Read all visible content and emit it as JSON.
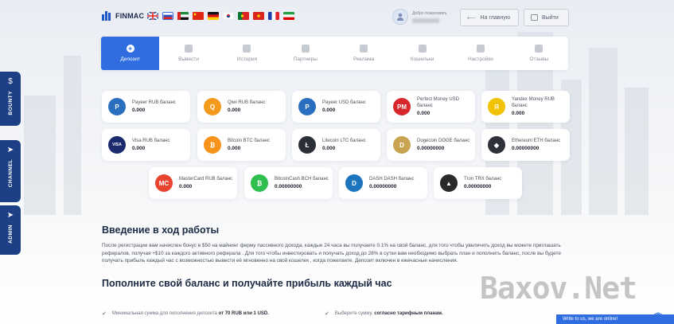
{
  "header": {
    "logo_text": "FINMAC",
    "languages": [
      "en",
      "ru",
      "ae",
      "cn",
      "de",
      "kr",
      "pt",
      "vn",
      "fr",
      "ir"
    ],
    "user_greeting": "Добро пожаловать",
    "home_button": "На главную",
    "logout_button": "Выйти"
  },
  "tabs": [
    {
      "label": "Депозит",
      "icon": "plus-icon",
      "active": true
    },
    {
      "label": "Вывести",
      "icon": "withdraw-icon",
      "active": false
    },
    {
      "label": "История",
      "icon": "history-icon",
      "active": false
    },
    {
      "label": "Партнеры",
      "icon": "partners-icon",
      "active": false
    },
    {
      "label": "Реклама",
      "icon": "ads-icon",
      "active": false
    },
    {
      "label": "Кошельки",
      "icon": "wallet-icon",
      "active": false
    },
    {
      "label": "Настройки",
      "icon": "gear-icon",
      "active": false
    },
    {
      "label": "Отзывы",
      "icon": "reviews-icon",
      "active": false
    }
  ],
  "balances": [
    {
      "label": "Payeer RUB баланс",
      "value": "0.000",
      "icon": "payeer-icon",
      "color": "#2a6fbf",
      "glyph": "P"
    },
    {
      "label": "Qiwi RUB баланс",
      "value": "0.000",
      "icon": "qiwi-icon",
      "color": "#f39a1d",
      "glyph": "Q"
    },
    {
      "label": "Payeer USD баланс",
      "value": "0.000",
      "icon": "payeer-icon",
      "color": "#2a6fbf",
      "glyph": "P"
    },
    {
      "label": "Perfect Money USD баланс",
      "value": "0.000",
      "icon": "perfect-money-icon",
      "color": "#d8262d",
      "glyph": "PM"
    },
    {
      "label": "Yandex Money RUB баланс",
      "value": "0.000",
      "icon": "yandex-money-icon",
      "color": "#f2c200",
      "glyph": "Я"
    },
    {
      "label": "Visa RUB баланс",
      "value": "0.000",
      "icon": "visa-icon",
      "color": "#1a2a6c",
      "glyph": "VISA"
    },
    {
      "label": "Bitcoin BTC баланс",
      "value": "0.000",
      "icon": "bitcoin-icon",
      "color": "#f7931a",
      "glyph": "₿"
    },
    {
      "label": "Litecoin LTC баланс",
      "value": "0.000",
      "icon": "litecoin-icon",
      "color": "#2b2f36",
      "glyph": "Ł"
    },
    {
      "label": "Dogecoin DOGE баланс",
      "value": "0.00000000",
      "icon": "dogecoin-icon",
      "color": "#c8a450",
      "glyph": "D"
    },
    {
      "label": "Ethereum ETH баланс",
      "value": "0.00000000",
      "icon": "ethereum-icon",
      "color": "#2e3138",
      "glyph": "◆"
    },
    {
      "label": "MasterCard RUB баланс",
      "value": "0.000",
      "icon": "mastercard-icon",
      "color": "#e8442f",
      "glyph": "MC"
    },
    {
      "label": "BitcoinCash BCH баланс",
      "value": "0.00000000",
      "icon": "bitcoin-cash-icon",
      "color": "#2fbf4f",
      "glyph": "₿"
    },
    {
      "label": "DASH DASH баланс",
      "value": "0.00000000",
      "icon": "dash-icon",
      "color": "#1c75bc",
      "glyph": "D"
    },
    {
      "label": "Tron TRX баланс",
      "value": "0.00000000",
      "icon": "tron-icon",
      "color": "#2a2a2a",
      "glyph": "▲"
    }
  ],
  "intro": {
    "title": "Введение в ход работы",
    "text": "После регистрации вам начислен бонус в $50 на майнинг ферму пассивного дохода, каждые 24 часа вы получаете 0.1% на свой баланс, для того чтобы увеличить доход вы можете приглашать рефералов, получая +$10 за каждого активного реферала . Для того чтобы инвестировать и получать доход до 28% в сутки вам необходимо выбрать план и пополнить баланс, после вы будете получать прибыль каждый час с возможностью вывести её мгновенно на свой кошелек , когда пожелаете. Депозит включен в ежечасные начисления."
  },
  "section2": {
    "title": "Пополните свой баланс и получайте прибыль каждый час",
    "bullet1_pre": "Минимальная сумма для пополнения депозита",
    "bullet1_bold": "от 70 RUB или 1 USD.",
    "bullet2_pre": "Выберите сумму,",
    "bullet2_bold": "согласно тарифным планам."
  },
  "sidebar": {
    "bounty": "BOUNTY",
    "channel": "CHANNEL",
    "admin": "ADMIN"
  },
  "watermark": "Baxov.Net",
  "chat": "Write to us, we are online!"
}
